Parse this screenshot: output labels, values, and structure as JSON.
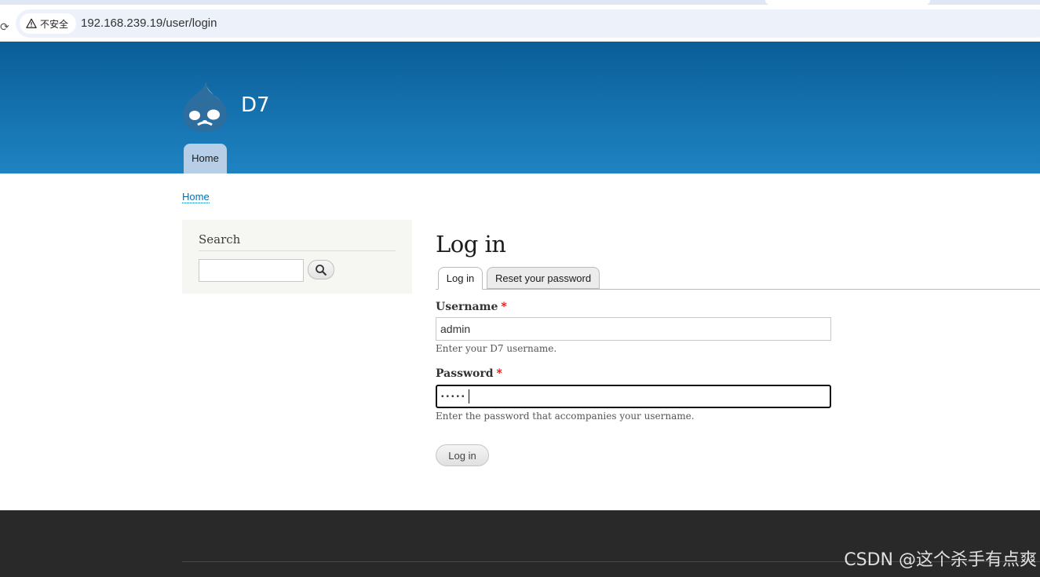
{
  "browser": {
    "security_label": "不安全",
    "url": "192.168.239.19/user/login"
  },
  "site": {
    "name": "D7",
    "main_nav": [
      {
        "label": "Home"
      }
    ]
  },
  "breadcrumb": {
    "label": "Home"
  },
  "sidebar": {
    "search_title": "Search",
    "search_value": ""
  },
  "page": {
    "title": "Log in",
    "tabs": [
      {
        "label": "Log in",
        "active": true
      },
      {
        "label": "Reset your password",
        "active": false
      }
    ],
    "username": {
      "label": "Username",
      "required_mark": "*",
      "value": "admin",
      "description": "Enter your D7 username."
    },
    "password": {
      "label": "Password",
      "required_mark": "*",
      "masked_value": "•••••",
      "description": "Enter the password that accompanies your username."
    },
    "submit_label": "Log in"
  },
  "footer": {
    "watermark": "CSDN @这个杀手有点爽"
  },
  "colors": {
    "header_top": "#0a5e98",
    "header_bottom": "#1f83c2",
    "link": "#0071b3",
    "footer": "#292929",
    "required": "#ee0000"
  }
}
